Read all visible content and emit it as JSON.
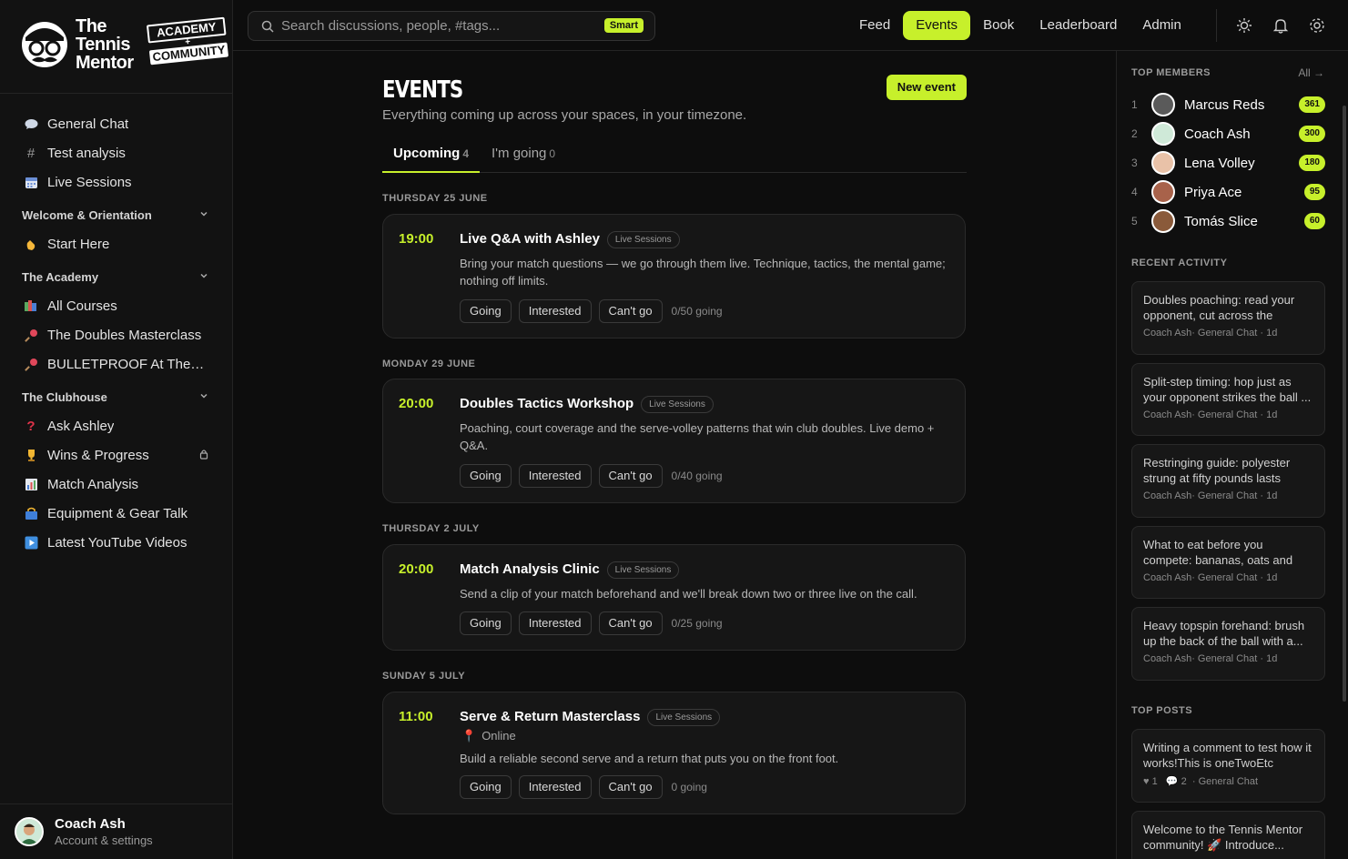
{
  "brand": {
    "line1": "The",
    "line2": "Tennis",
    "line3": "Mentor",
    "badge1": "ACADEMY",
    "badge_plus": "+",
    "badge2": "COMMUNITY"
  },
  "sidebar": {
    "top_items": [
      {
        "label": "General Chat",
        "icon": "chat-bubble-icon"
      },
      {
        "label": "Test analysis",
        "icon": "hash-icon"
      },
      {
        "label": "Live Sessions",
        "icon": "calendar-icon"
      }
    ],
    "sections": [
      {
        "title": "Welcome & Orientation",
        "items": [
          {
            "label": "Start Here",
            "icon": "waving-hand-icon"
          }
        ]
      },
      {
        "title": "The Academy",
        "items": [
          {
            "label": "All Courses",
            "icon": "books-icon"
          },
          {
            "label": "The Doubles Masterclass",
            "icon": "racket-icon"
          },
          {
            "label": "BULLETPROOF At The B...",
            "icon": "racket-icon"
          }
        ]
      },
      {
        "title": "The Clubhouse",
        "items": [
          {
            "label": "Ask Ashley",
            "icon": "question-icon"
          },
          {
            "label": "Wins & Progress",
            "icon": "trophy-icon",
            "locked": true
          },
          {
            "label": "Match Analysis",
            "icon": "chart-icon"
          },
          {
            "label": "Equipment & Gear Talk",
            "icon": "bag-icon"
          },
          {
            "label": "Latest YouTube Videos",
            "icon": "play-icon"
          }
        ]
      }
    ],
    "user": {
      "name": "Coach Ash",
      "sub": "Account & settings"
    }
  },
  "topbar": {
    "search_placeholder": "Search discussions, people, #tags...",
    "smart_label": "Smart",
    "nav": [
      "Feed",
      "Events",
      "Book",
      "Leaderboard",
      "Admin"
    ],
    "active_nav": "Events"
  },
  "main": {
    "title": "EVENTS",
    "subtitle": "Everything coming up across your spaces, in your timezone.",
    "new_event_label": "New event",
    "tabs": [
      {
        "label": "Upcoming",
        "count": "4"
      },
      {
        "label": "I'm going",
        "count": "0"
      }
    ],
    "days": [
      "THURSDAY 25 JUNE",
      "MONDAY 29 JUNE",
      "THURSDAY 2 JULY",
      "SUNDAY 5 JULY"
    ],
    "events": [
      {
        "time": "19:00",
        "title": "Live Q&A with Ashley",
        "tag": "Live Sessions",
        "desc": "Bring your match questions — we go through them live. Technique, tactics, the mental game; nothing off limits.",
        "going": "0/50 going"
      },
      {
        "time": "20:00",
        "title": "Doubles Tactics Workshop",
        "tag": "Live Sessions",
        "desc": "Poaching, court coverage and the serve-volley patterns that win club doubles. Live demo + Q&A.",
        "going": "0/40 going"
      },
      {
        "time": "20:00",
        "title": "Match Analysis Clinic",
        "tag": "Live Sessions",
        "desc": "Send a clip of your match beforehand and we'll break down two or three live on the call.",
        "going": "0/25 going"
      },
      {
        "time": "11:00",
        "title": "Serve & Return Masterclass",
        "tag": "Live Sessions",
        "location": "Online",
        "desc": "Build a reliable second serve and a return that puts you on the front foot.",
        "going": "0 going"
      }
    ],
    "buttons": {
      "going": "Going",
      "interested": "Interested",
      "cant": "Can't go"
    }
  },
  "rightbar": {
    "top_members_title": "TOP MEMBERS",
    "all_label": "All →",
    "members": [
      {
        "rank": "1",
        "name": "Marcus Reds",
        "points": "361"
      },
      {
        "rank": "2",
        "name": "Coach Ash",
        "points": "300"
      },
      {
        "rank": "3",
        "name": "Lena Volley",
        "points": "180"
      },
      {
        "rank": "4",
        "name": "Priya Ace",
        "points": "95"
      },
      {
        "rank": "5",
        "name": "Tomás Slice",
        "points": "60"
      }
    ],
    "recent_title": "RECENT ACTIVITY",
    "recent": [
      {
        "text": "Doubles poaching: read your opponent, cut across the middl...",
        "meta": "Coach Ash· General Chat · 1d"
      },
      {
        "text": "Split-step timing: hop just as your opponent strikes the ball ...",
        "meta": "Coach Ash· General Chat · 1d"
      },
      {
        "text": "Restringing guide: polyester strung at fifty pounds lasts abo...",
        "meta": "Coach Ash· General Chat · 1d"
      },
      {
        "text": "What to eat before you compete: bananas, oats and plenty of...",
        "meta": "Coach Ash· General Chat · 1d"
      },
      {
        "text": "Heavy topspin forehand: brush up the back of the ball with a...",
        "meta": "Coach Ash· General Chat · 1d"
      }
    ],
    "top_posts_title": "TOP POSTS",
    "posts": [
      {
        "text": "Writing a comment to test how it works!This is oneTwoEtc",
        "likes": "1",
        "comments": "2",
        "space": "· General Chat"
      },
      {
        "text": "Welcome to the Tennis Mentor community! 🚀 Introduce..."
      }
    ]
  },
  "colors": {
    "accent": "#c7f02b",
    "bg": "#0d0d0d",
    "card": "#161616"
  }
}
